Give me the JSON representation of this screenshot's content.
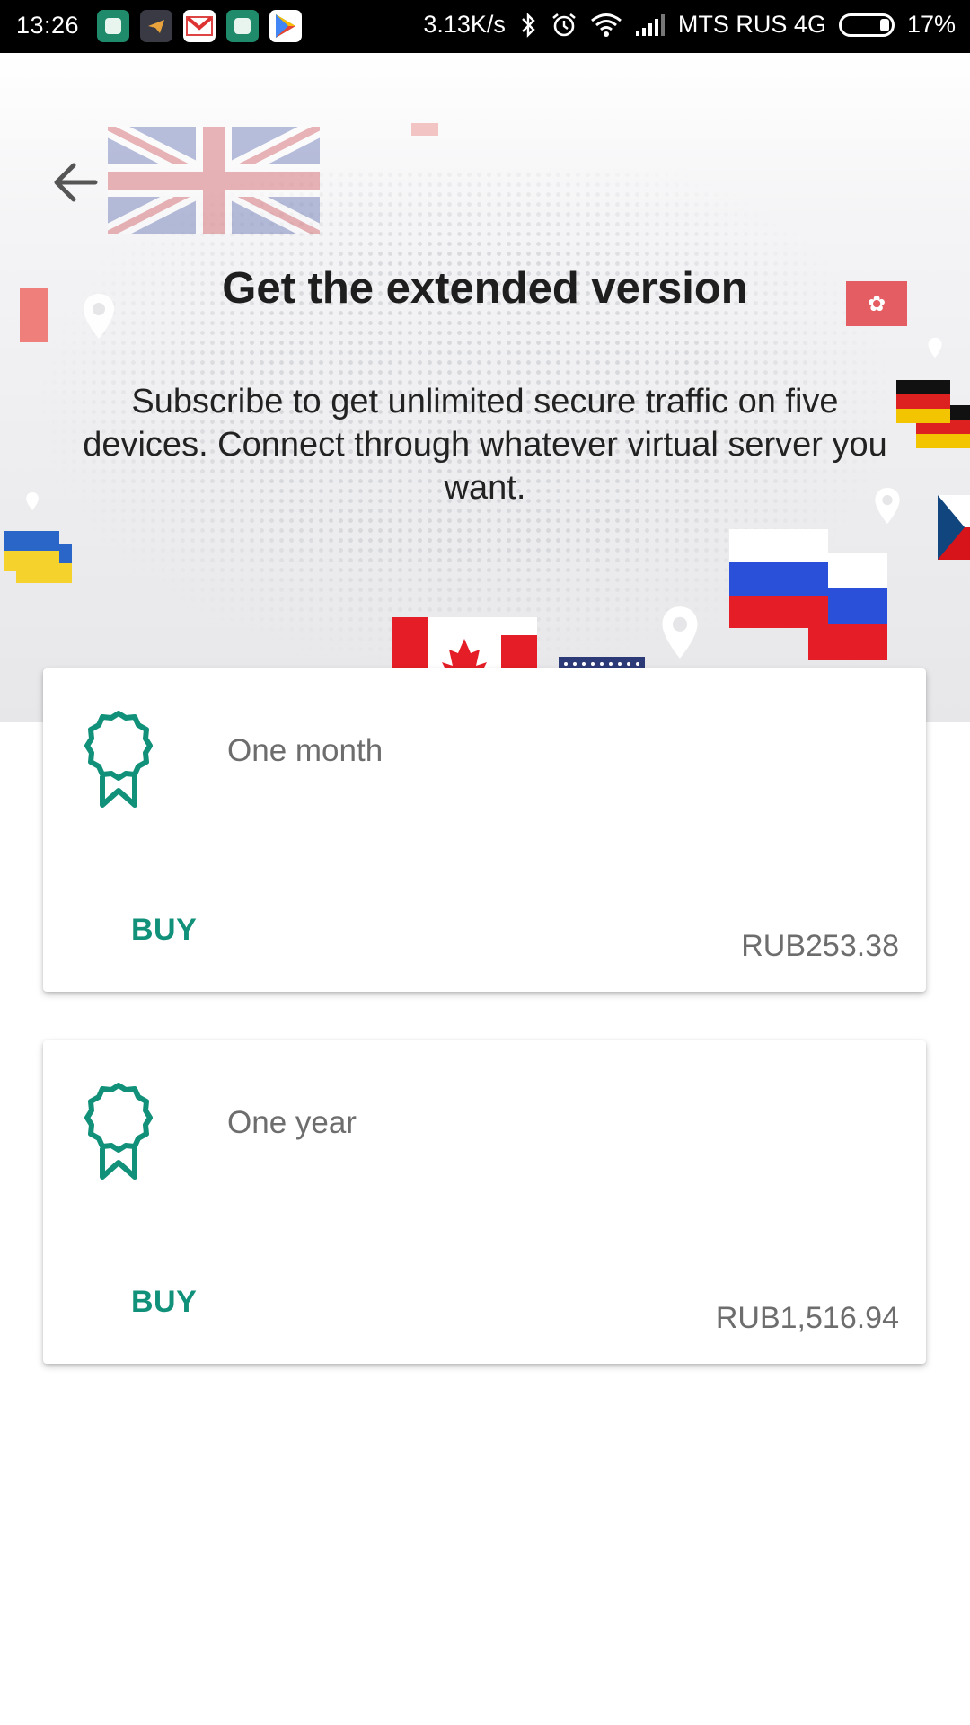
{
  "status_bar": {
    "time": "13:26",
    "speed": "3.13K/s",
    "carrier": "MTS RUS 4G",
    "battery": "17%",
    "notification_icons": [
      "vpn-app-icon",
      "telegram-icon",
      "gmail-icon",
      "vpn-app-icon",
      "play-store-icon"
    ]
  },
  "hero": {
    "title": "Get the extended version",
    "subtitle": "Subscribe to get unlimited secure traffic on five devices. Connect through whatever virtual server you want."
  },
  "plans": [
    {
      "name": "One month",
      "buy_label": "BUY",
      "price": "RUB253.38"
    },
    {
      "name": "One year",
      "buy_label": "BUY",
      "price": "RUB1,516.94"
    }
  ],
  "colors": {
    "accent": "#11917a",
    "title": "#1e1e1e",
    "secondary_text": "#6d6d6d"
  }
}
